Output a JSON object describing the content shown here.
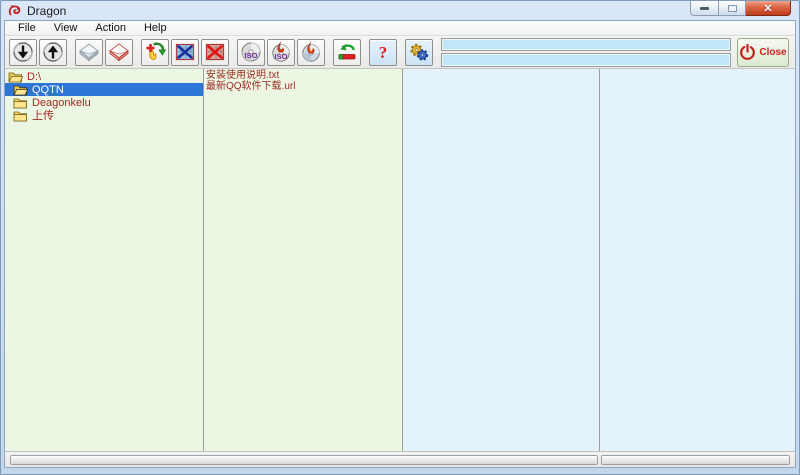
{
  "window": {
    "title": "Dragon"
  },
  "menu": {
    "items": [
      "File",
      "View",
      "Action",
      "Help"
    ]
  },
  "toolbar": {
    "buttons": [
      {
        "name": "download-from-disc"
      },
      {
        "name": "upload-to-disc"
      },
      {
        "name": "erase-disc-quick"
      },
      {
        "name": "erase-disc-full"
      },
      {
        "name": "write-files"
      },
      {
        "name": "delete-files"
      },
      {
        "name": "delete-all-files"
      },
      {
        "name": "create-iso"
      },
      {
        "name": "burn-iso"
      },
      {
        "name": "burn-disc"
      },
      {
        "name": "eject-disc"
      },
      {
        "name": "help"
      },
      {
        "name": "settings"
      }
    ],
    "iso_text": "ISO",
    "help_text": "?",
    "close_label": "Close"
  },
  "explorer": {
    "tree": {
      "items": [
        {
          "label": "D:\\",
          "icon": "open-folder",
          "selected": false,
          "level": 0
        },
        {
          "label": "QQTN",
          "icon": "open-folder",
          "selected": true,
          "level": 1
        },
        {
          "label": "Deagonkelu",
          "icon": "closed-folder",
          "selected": false,
          "level": 1
        },
        {
          "label": "上传",
          "icon": "closed-folder",
          "selected": false,
          "level": 1
        }
      ]
    },
    "files": {
      "items": [
        "安装使用说明.txt",
        "最新QQ软件下载.url"
      ]
    }
  },
  "colors": {
    "panel_green": "#ebf6e3",
    "panel_blue": "#e4f2fb",
    "progress_track": "#bfe7f8",
    "selection_blue": "#2e75d8",
    "tree_text": "#9c2a21",
    "close_accent": "#c32121"
  }
}
